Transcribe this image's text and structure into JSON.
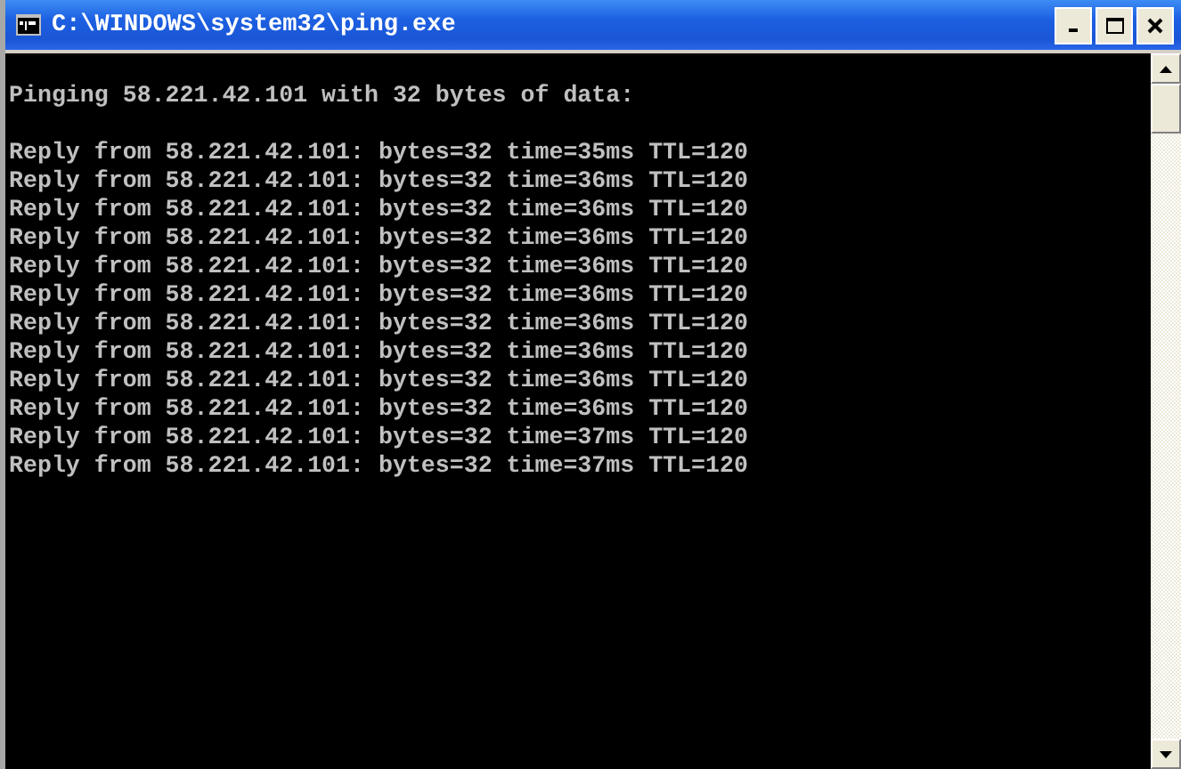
{
  "window": {
    "title": "C:\\WINDOWS\\system32\\ping.exe"
  },
  "console": {
    "header": "Pinging 58.221.42.101 with 32 bytes of data:",
    "replies": [
      "Reply from 58.221.42.101: bytes=32 time=35ms TTL=120",
      "Reply from 58.221.42.101: bytes=32 time=36ms TTL=120",
      "Reply from 58.221.42.101: bytes=32 time=36ms TTL=120",
      "Reply from 58.221.42.101: bytes=32 time=36ms TTL=120",
      "Reply from 58.221.42.101: bytes=32 time=36ms TTL=120",
      "Reply from 58.221.42.101: bytes=32 time=36ms TTL=120",
      "Reply from 58.221.42.101: bytes=32 time=36ms TTL=120",
      "Reply from 58.221.42.101: bytes=32 time=36ms TTL=120",
      "Reply from 58.221.42.101: bytes=32 time=36ms TTL=120",
      "Reply from 58.221.42.101: bytes=32 time=36ms TTL=120",
      "Reply from 58.221.42.101: bytes=32 time=37ms TTL=120",
      "Reply from 58.221.42.101: bytes=32 time=37ms TTL=120"
    ]
  }
}
